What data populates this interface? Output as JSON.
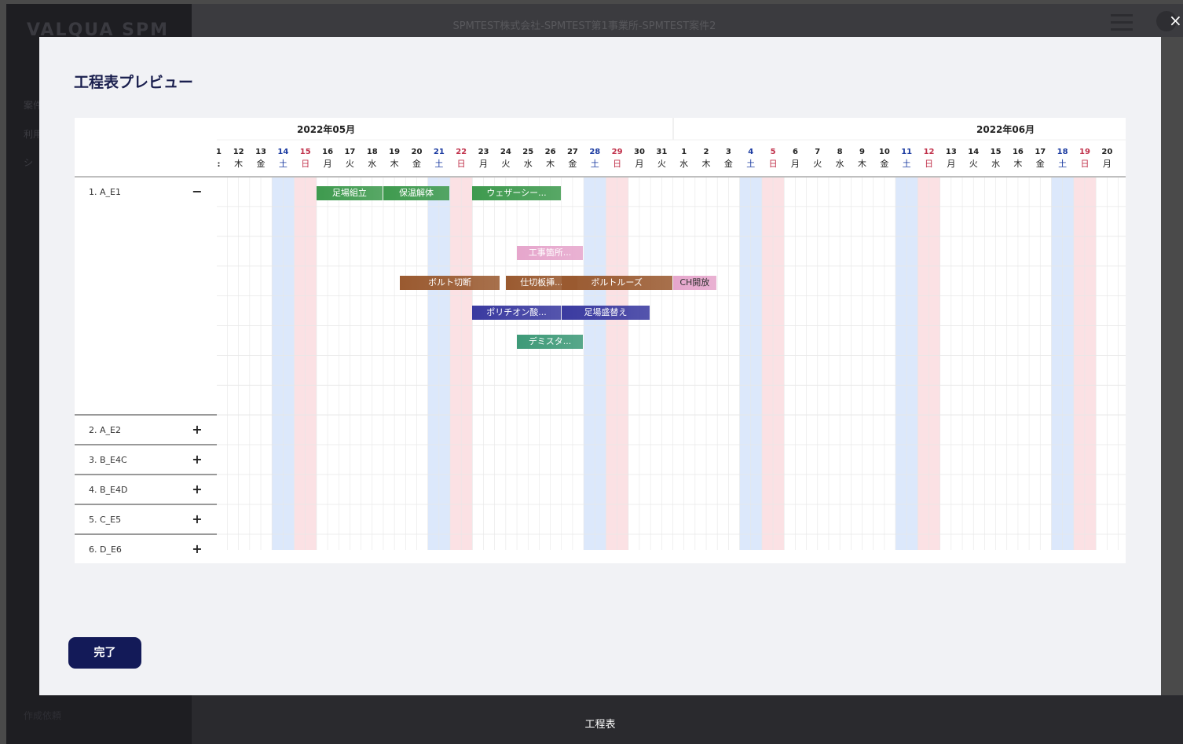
{
  "app": {
    "logo": "VALQUA SPM",
    "header_title": "SPMTEST株式会社-SPMTEST第1事業所-SPMTEST案件2",
    "sidebar_tip1": "案件",
    "sidebar_tip2": "利用",
    "sidebar_tip3": "シ",
    "sidebar_bottom": "作成依頼",
    "footer_label": "工程表"
  },
  "modal": {
    "title": "工程表プレビュー",
    "close_glyph": "×",
    "done_label": "完了"
  },
  "calendar": {
    "months": [
      {
        "label": "2022年05月"
      },
      {
        "label": "2022年06月"
      }
    ],
    "leading_partial": {
      "day": "1",
      "weekday": ":"
    },
    "days": [
      {
        "day": "12",
        "weekday": "木",
        "type": "weekday"
      },
      {
        "day": "13",
        "weekday": "金",
        "type": "weekday"
      },
      {
        "day": "14",
        "weekday": "土",
        "type": "saturday"
      },
      {
        "day": "15",
        "weekday": "日",
        "type": "sunday"
      },
      {
        "day": "16",
        "weekday": "月",
        "type": "weekday"
      },
      {
        "day": "17",
        "weekday": "火",
        "type": "weekday"
      },
      {
        "day": "18",
        "weekday": "水",
        "type": "weekday"
      },
      {
        "day": "19",
        "weekday": "木",
        "type": "weekday"
      },
      {
        "day": "20",
        "weekday": "金",
        "type": "weekday"
      },
      {
        "day": "21",
        "weekday": "土",
        "type": "saturday"
      },
      {
        "day": "22",
        "weekday": "日",
        "type": "sunday"
      },
      {
        "day": "23",
        "weekday": "月",
        "type": "weekday"
      },
      {
        "day": "24",
        "weekday": "火",
        "type": "weekday"
      },
      {
        "day": "25",
        "weekday": "水",
        "type": "weekday"
      },
      {
        "day": "26",
        "weekday": "木",
        "type": "weekday"
      },
      {
        "day": "27",
        "weekday": "金",
        "type": "weekday"
      },
      {
        "day": "28",
        "weekday": "土",
        "type": "saturday"
      },
      {
        "day": "29",
        "weekday": "日",
        "type": "sunday"
      },
      {
        "day": "30",
        "weekday": "月",
        "type": "weekday"
      },
      {
        "day": "31",
        "weekday": "火",
        "type": "weekday"
      },
      {
        "day": "1",
        "weekday": "水",
        "type": "weekday"
      },
      {
        "day": "2",
        "weekday": "木",
        "type": "weekday"
      },
      {
        "day": "3",
        "weekday": "金",
        "type": "weekday"
      },
      {
        "day": "4",
        "weekday": "土",
        "type": "saturday"
      },
      {
        "day": "5",
        "weekday": "日",
        "type": "sunday"
      },
      {
        "day": "6",
        "weekday": "月",
        "type": "weekday"
      },
      {
        "day": "7",
        "weekday": "火",
        "type": "weekday"
      },
      {
        "day": "8",
        "weekday": "水",
        "type": "weekday"
      },
      {
        "day": "9",
        "weekday": "木",
        "type": "weekday"
      },
      {
        "day": "10",
        "weekday": "金",
        "type": "weekday"
      },
      {
        "day": "11",
        "weekday": "土",
        "type": "saturday"
      },
      {
        "day": "12",
        "weekday": "日",
        "type": "sunday"
      },
      {
        "day": "13",
        "weekday": "月",
        "type": "weekday"
      },
      {
        "day": "14",
        "weekday": "火",
        "type": "weekday"
      },
      {
        "day": "15",
        "weekday": "水",
        "type": "weekday"
      },
      {
        "day": "16",
        "weekday": "木",
        "type": "weekday"
      },
      {
        "day": "17",
        "weekday": "金",
        "type": "weekday"
      },
      {
        "day": "18",
        "weekday": "土",
        "type": "saturday"
      },
      {
        "day": "19",
        "weekday": "日",
        "type": "sunday"
      },
      {
        "day": "20",
        "weekday": "月",
        "type": "weekday"
      }
    ]
  },
  "groups": [
    {
      "label": "1. A_E1",
      "toggle": "−",
      "expanded": true
    },
    {
      "label": "2. A_E2",
      "toggle": "+",
      "expanded": false
    },
    {
      "label": "3. B_E4C",
      "toggle": "+",
      "expanded": false
    },
    {
      "label": "4. B_E4D",
      "toggle": "+",
      "expanded": false
    },
    {
      "label": "5. C_E5",
      "toggle": "+",
      "expanded": false
    },
    {
      "label": "6. D_E6",
      "toggle": "+",
      "expanded": false
    }
  ],
  "tasks": [
    {
      "label": "足場組立",
      "start": "2022-05-16",
      "end": "2022-05-18",
      "row": 1,
      "color": "#3e9a4e"
    },
    {
      "label": "保温解体",
      "start": "2022-05-19",
      "end": "2022-05-21",
      "row": 1,
      "color": "#3e9a4e"
    },
    {
      "label": "ウェザーシー...",
      "start": "2022-05-23",
      "end": "2022-05-26",
      "row": 1,
      "color": "#3e9a4e"
    },
    {
      "label": "工事箇所...",
      "start": "2022-05-25",
      "end": "2022-05-27",
      "row": 3,
      "color": "#e6a6cc"
    },
    {
      "label": "ボルト切断",
      "start": "2022-05-19.75",
      "end": "2022-05-23.25",
      "row": 4,
      "color": "#9a5a30"
    },
    {
      "label": "仕切板挿...",
      "start": "2022-05-24.5",
      "end": "2022-05-26.75",
      "row": 4,
      "color": "#9a5a30"
    },
    {
      "label": "ボルトルーズ",
      "start": "2022-05-27",
      "end": "2022-05-31",
      "row": 4,
      "color": "#9a5a30"
    },
    {
      "label": "CH開放",
      "start": "2022-06-01",
      "end": "2022-06-02",
      "row": 4,
      "color": "#e6a6cc",
      "text_color": "#333333"
    },
    {
      "label": "ポリチオン酸...",
      "start": "2022-05-23",
      "end": "2022-05-26",
      "row": 5,
      "color": "#3a3aa0"
    },
    {
      "label": "足場盛替え",
      "start": "2022-05-27",
      "end": "2022-05-30",
      "row": 5,
      "color": "#3a3aa0"
    },
    {
      "label": "デミスタ...",
      "start": "2022-05-25",
      "end": "2022-05-27",
      "row": 6,
      "color": "#3e9a78"
    }
  ],
  "colors": {
    "saturday": "#dce8fb",
    "sunday": "#fbe1e4",
    "grid": "#e7e7e7",
    "navy": "#131a58"
  }
}
